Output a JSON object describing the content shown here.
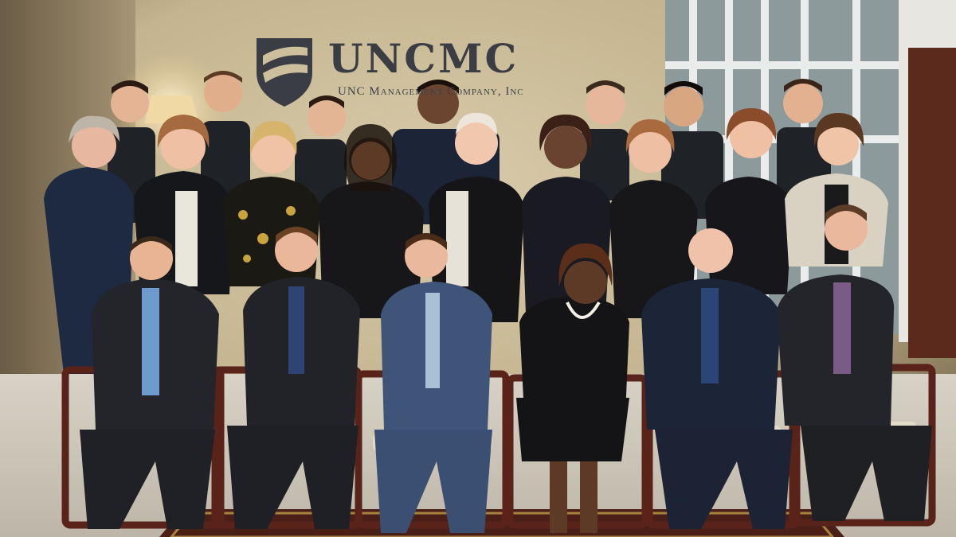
{
  "photo": {
    "scene": "group-portrait",
    "logo": {
      "wordmark": "UNCMC",
      "tagline": "UNC Management Company, Inc"
    },
    "people": {
      "seated_count": 6,
      "standing_count": 17,
      "total": 23
    },
    "colors": {
      "wall": "#cdbf9c",
      "logo": "#3a3e44",
      "chair_wood": "#5a231a",
      "suit_navy": "#1f2838",
      "suit_charcoal": "#25272c",
      "rug": "#4a1f18"
    }
  }
}
